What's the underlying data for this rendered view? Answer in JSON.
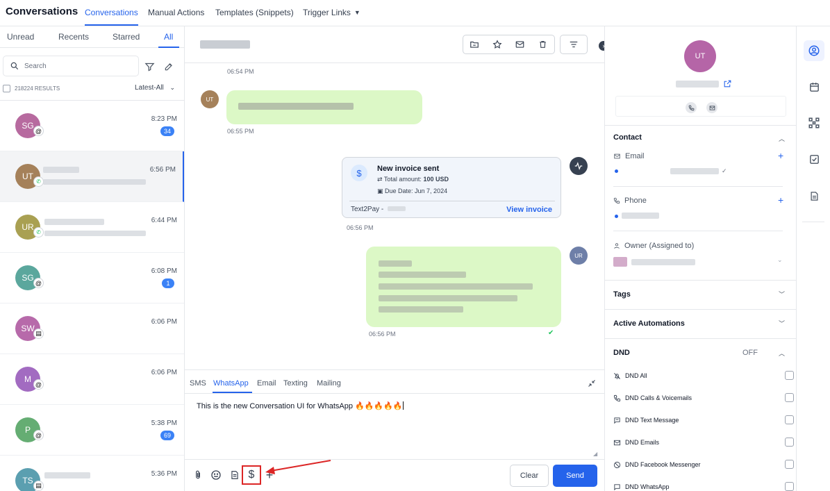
{
  "app": {
    "title": "Conversations"
  },
  "topnav": {
    "items": [
      "Conversations",
      "Manual Actions",
      "Templates (Snippets)",
      "Trigger Links"
    ]
  },
  "list": {
    "tabs": [
      "Unread",
      "Recents",
      "Starred",
      "All"
    ],
    "search_placeholder": "Search",
    "results_label": "218224 RESULTS",
    "sort_label": "Latest-All",
    "rows": [
      {
        "initials": "SG",
        "time": "8:23 PM",
        "badge": "34",
        "color": "#b76a9f"
      },
      {
        "initials": "UT",
        "time": "6:56 PM",
        "badge": "",
        "color": "#a5815a"
      },
      {
        "initials": "UR",
        "time": "6:44 PM",
        "badge": "",
        "color": "#a9a052"
      },
      {
        "initials": "SG",
        "time": "6:08 PM",
        "badge": "1",
        "color": "#5ba79d"
      },
      {
        "initials": "SW",
        "time": "6:06 PM",
        "badge": "",
        "color": "#b76aaa"
      },
      {
        "initials": "M",
        "time": "6:06 PM",
        "badge": "",
        "color": "#a26bc1"
      },
      {
        "initials": "P",
        "time": "5:38 PM",
        "badge": "69",
        "color": "#65ad73"
      },
      {
        "initials": "TS",
        "time": "5:36 PM",
        "badge": "",
        "color": "#5b9fb0"
      }
    ]
  },
  "chat": {
    "timestamps": [
      "06:54 PM",
      "06:55 PM",
      "06:56 PM",
      "06:56 PM"
    ],
    "incoming_avatar": "UT",
    "outgoing_avatar": "UR",
    "invoice": {
      "title": "New invoice sent",
      "amount_label": "Total amount:",
      "amount_value": "100 USD",
      "due_label": "Due Date: Jun 7, 2024",
      "provider": "Text2Pay -",
      "link": "View invoice"
    }
  },
  "composer": {
    "tabs": [
      "SMS",
      "WhatsApp",
      "Email",
      "Texting",
      "Mailing"
    ],
    "message": "This is the new Conversation UI for WhatsApp 🔥🔥🔥🔥🔥",
    "clear_label": "Clear",
    "send_label": "Send"
  },
  "contact_panel": {
    "avatar": "UT",
    "sections": {
      "contact": "Contact",
      "email_label": "Email",
      "phone_label": "Phone",
      "owner_label": "Owner (Assigned to)",
      "tags": "Tags",
      "automations": "Active Automations",
      "dnd": "DND",
      "dnd_state": "OFF"
    },
    "dnd_items": [
      "DND All",
      "DND Calls & Voicemails",
      "DND Text Message",
      "DND Emails",
      "DND Facebook Messenger",
      "DND WhatsApp"
    ]
  }
}
